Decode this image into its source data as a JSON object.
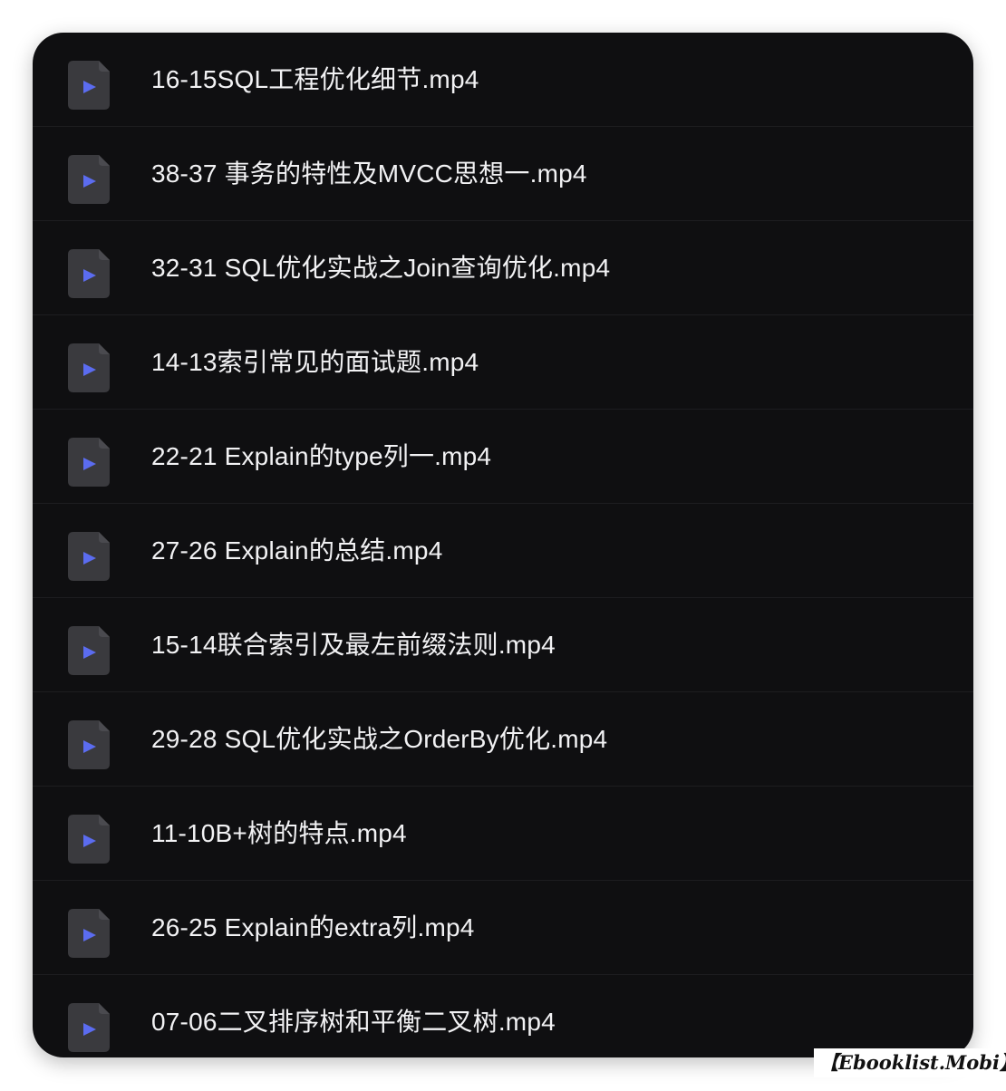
{
  "files": [
    {
      "name": "16-15SQL工程优化细节.mp4",
      "icon": "video-file-icon"
    },
    {
      "name": "38-37 事务的特性及MVCC思想一.mp4",
      "icon": "video-file-icon"
    },
    {
      "name": "32-31 SQL优化实战之Join查询优化.mp4",
      "icon": "video-file-icon"
    },
    {
      "name": "14-13索引常见的面试题.mp4",
      "icon": "video-file-icon"
    },
    {
      "name": "22-21 Explain的type列一.mp4",
      "icon": "video-file-icon"
    },
    {
      "name": "27-26 Explain的总结.mp4",
      "icon": "video-file-icon"
    },
    {
      "name": "15-14联合索引及最左前缀法则.mp4",
      "icon": "video-file-icon"
    },
    {
      "name": "29-28 SQL优化实战之OrderBy优化.mp4",
      "icon": "video-file-icon"
    },
    {
      "name": "11-10B+树的特点.mp4",
      "icon": "video-file-icon"
    },
    {
      "name": "26-25 Explain的extra列.mp4",
      "icon": "video-file-icon"
    },
    {
      "name": "07-06二叉排序树和平衡二叉树.mp4",
      "icon": "video-file-icon"
    }
  ],
  "colors": {
    "panel_background": "#0f0f11",
    "row_divider": "#1d1d20",
    "file_icon": "#3a3a3e",
    "play_glyph": "#5b6cf0",
    "text": "#f2f2f4"
  },
  "watermark": "【Ebooklist.Mobi】"
}
